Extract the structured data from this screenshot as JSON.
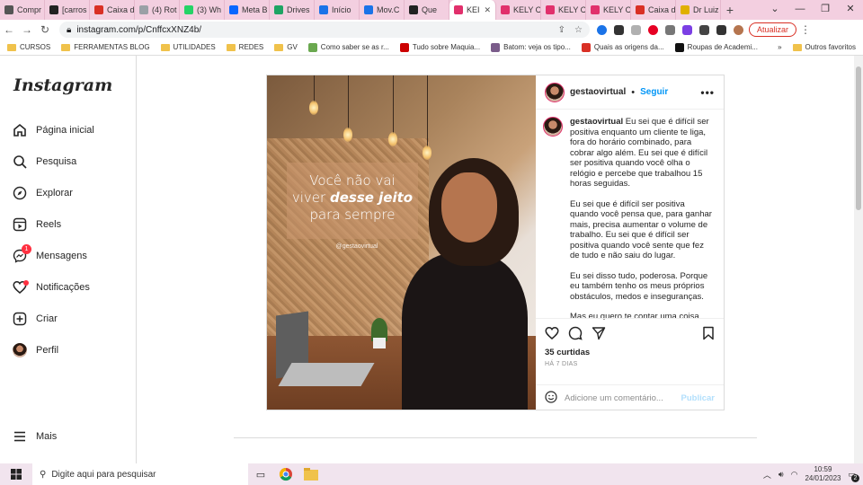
{
  "browser": {
    "tabs": [
      {
        "label": "Compr",
        "color": "#555555"
      },
      {
        "label": "[carros",
        "color": "#222222"
      },
      {
        "label": "Caixa d",
        "color": "#d93025"
      },
      {
        "label": "(4) Rot",
        "color": "#9aa0a6"
      },
      {
        "label": "(3) Wh",
        "color": "#25d366"
      },
      {
        "label": "Meta B",
        "color": "#0866ff"
      },
      {
        "label": "Drives",
        "color": "#1fa463"
      },
      {
        "label": "Início",
        "color": "#1a73e8"
      },
      {
        "label": "Mov.C",
        "color": "#1a73e8"
      },
      {
        "label": "Que",
        "color": "#222222"
      },
      {
        "label": "KEI",
        "color": "#e1306c",
        "active": true
      },
      {
        "label": "KELY C",
        "color": "#e1306c"
      },
      {
        "label": "KELY C",
        "color": "#e1306c"
      },
      {
        "label": "KELY C",
        "color": "#e1306c"
      },
      {
        "label": "Caixa d",
        "color": "#d93025"
      },
      {
        "label": "Dr Luiz",
        "color": "#e0b000"
      }
    ],
    "new_tab": "+",
    "close_tab": "✕",
    "url": "instagram.com/p/CnffcxXNZ4b/",
    "update_button": "Atualizar",
    "bookmarks": [
      {
        "label": "CURSOS",
        "type": "folder"
      },
      {
        "label": "FERRAMENTAS BLOG",
        "type": "folder"
      },
      {
        "label": "UTILIDADES",
        "type": "folder"
      },
      {
        "label": "REDES",
        "type": "folder"
      },
      {
        "label": "GV",
        "type": "folder"
      },
      {
        "label": "Como saber se as r...",
        "type": "link",
        "color": "#6aa84f"
      },
      {
        "label": "Tudo sobre Maquia...",
        "type": "link",
        "color": "#cc0000"
      },
      {
        "label": "Batom: veja os tipo...",
        "type": "link",
        "color": "#7a5c8a"
      },
      {
        "label": "Quais as origens da...",
        "type": "link",
        "color": "#d93025"
      },
      {
        "label": "Roupas de Academi...",
        "type": "link",
        "color": "#111111"
      }
    ],
    "bookmarks_overflow": "»",
    "other_bookmarks": "Outros favoritos"
  },
  "sidebar": {
    "logo": "Instagram",
    "items": [
      {
        "label": "Página inicial",
        "icon": "home-icon"
      },
      {
        "label": "Pesquisa",
        "icon": "search-icon"
      },
      {
        "label": "Explorar",
        "icon": "compass-icon"
      },
      {
        "label": "Reels",
        "icon": "reels-icon"
      },
      {
        "label": "Mensagens",
        "icon": "messenger-icon",
        "badge": "1"
      },
      {
        "label": "Notificações",
        "icon": "heart-icon"
      },
      {
        "label": "Criar",
        "icon": "plus-square-icon"
      },
      {
        "label": "Perfil",
        "icon": "avatar"
      }
    ],
    "more": "Mais"
  },
  "post": {
    "image_text": {
      "line1": "Você não vai",
      "line2_plain": "viver ",
      "line2_bold": "desse jeito",
      "line3": "para sempre",
      "handle": "@gestaovirtual"
    },
    "username": "gestaovirtual",
    "separator": "•",
    "follow": "Seguir",
    "more": "•••",
    "caption_paragraphs": [
      "Eu sei que é difícil ser positiva enquanto um cliente te liga, fora do horário combinado, para cobrar algo além. Eu sei que é difícil ser positiva quando você olha o relógio e percebe que trabalhou 15 horas seguidas.",
      "Eu sei que é difícil ser positiva quando você pensa que, para ganhar mais, precisa aumentar o volume de trabalho. Eu sei que é difícil ser positiva quando você sente que fez de tudo e não saiu do lugar.",
      "Eu sei disso tudo, poderosa. Porque eu também tenho os meus próprios obstáculos, medos e inseguranças.",
      "Mas eu quero te contar uma coisa"
    ],
    "likes": "35 curtidas",
    "time": "HÁ 7 DIAS",
    "comment_placeholder": "Adicione um comentário...",
    "publish": "Publicar"
  },
  "taskbar": {
    "search_placeholder": "Digite aqui para pesquisar",
    "time": "10:59",
    "date": "24/01/2023",
    "notifications": "2"
  }
}
